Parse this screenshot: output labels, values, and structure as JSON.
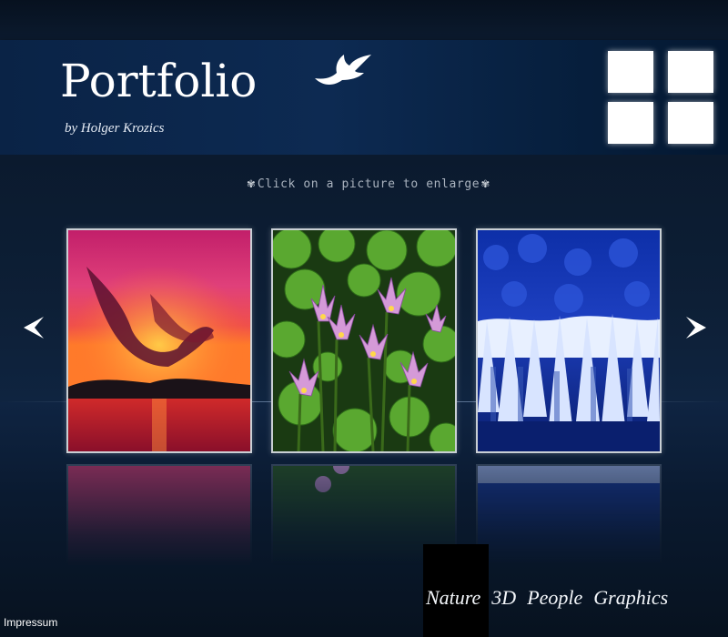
{
  "header": {
    "title": "Portfolio",
    "subtitle": "by Holger Krozics",
    "logo_icon": "bird-icon",
    "view_toggle_icon": "grid-view-icon"
  },
  "hint": {
    "text": "Click on a picture to enlarge",
    "left_ornament": "✾",
    "right_ornament": "✾"
  },
  "carousel": {
    "prev_icon": "chevron-left-icon",
    "next_icon": "chevron-right-icon",
    "photos": [
      {
        "subject": "sunset over lake",
        "icon": "sunset-photo"
      },
      {
        "subject": "pink water lilies",
        "icon": "water-lily-photo"
      },
      {
        "subject": "frosted blue forest",
        "icon": "snow-forest-photo"
      }
    ]
  },
  "categories": {
    "active": "Nature",
    "items": [
      "Nature",
      "3D",
      "People",
      "Graphics"
    ]
  },
  "footer": {
    "impressum": "Impressum"
  },
  "colors": {
    "background": "#0a1628",
    "header": "#0d2a52",
    "active_category_bg": "#000000",
    "text": "#ffffff"
  }
}
